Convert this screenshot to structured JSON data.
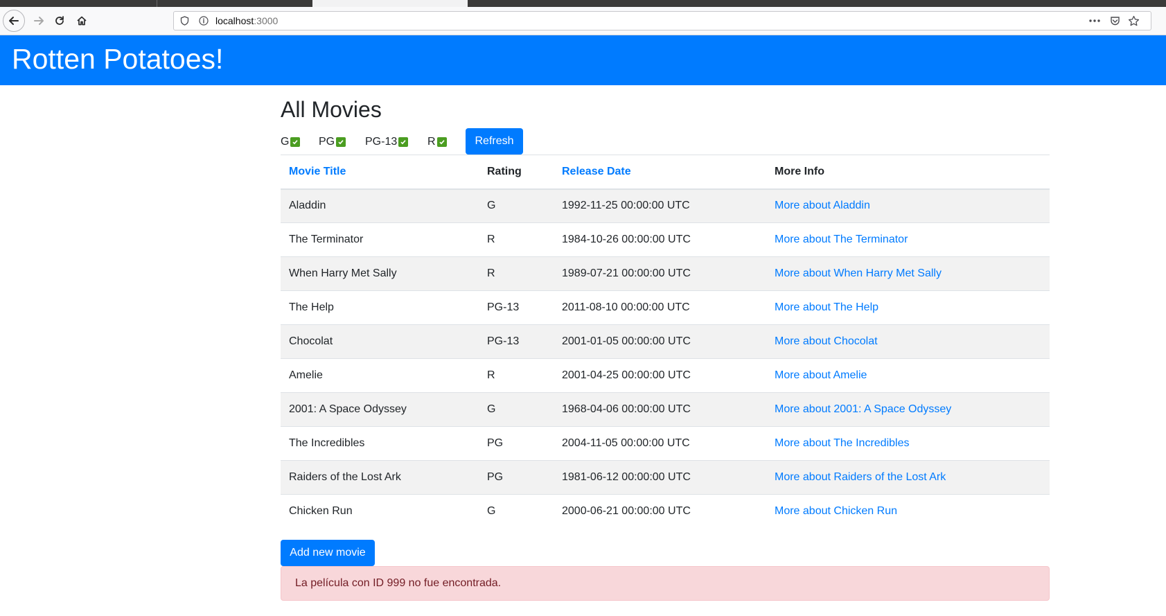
{
  "browser": {
    "url_host": "localhost",
    "url_port": ":3000"
  },
  "header": {
    "title": "Rotten Potatoes!",
    "color": "#007bff"
  },
  "main": {
    "title": "All Movies",
    "ratings": [
      {
        "label": "G",
        "checked": true
      },
      {
        "label": "PG",
        "checked": true
      },
      {
        "label": "PG-13",
        "checked": true
      },
      {
        "label": "R",
        "checked": true
      }
    ],
    "refresh_label": "Refresh",
    "columns": [
      "Movie Title",
      "Rating",
      "Release Date",
      "More Info"
    ],
    "movies": [
      {
        "title": "Aladdin",
        "rating": "G",
        "release_date": "1992-11-25 00:00:00 UTC",
        "more_info": "More about Aladdin"
      },
      {
        "title": "The Terminator",
        "rating": "R",
        "release_date": "1984-10-26 00:00:00 UTC",
        "more_info": "More about The Terminator"
      },
      {
        "title": "When Harry Met Sally",
        "rating": "R",
        "release_date": "1989-07-21 00:00:00 UTC",
        "more_info": "More about When Harry Met Sally"
      },
      {
        "title": "The Help",
        "rating": "PG-13",
        "release_date": "2011-08-10 00:00:00 UTC",
        "more_info": "More about The Help"
      },
      {
        "title": "Chocolat",
        "rating": "PG-13",
        "release_date": "2001-01-05 00:00:00 UTC",
        "more_info": "More about Chocolat"
      },
      {
        "title": "Amelie",
        "rating": "R",
        "release_date": "2001-04-25 00:00:00 UTC",
        "more_info": "More about Amelie"
      },
      {
        "title": "2001: A Space Odyssey",
        "rating": "G",
        "release_date": "1968-04-06 00:00:00 UTC",
        "more_info": "More about 2001: A Space Odyssey"
      },
      {
        "title": "The Incredibles",
        "rating": "PG",
        "release_date": "2004-11-05 00:00:00 UTC",
        "more_info": "More about The Incredibles"
      },
      {
        "title": "Raiders of the Lost Ark",
        "rating": "PG",
        "release_date": "1981-06-12 00:00:00 UTC",
        "more_info": "More about Raiders of the Lost Ark"
      },
      {
        "title": "Chicken Run",
        "rating": "G",
        "release_date": "2000-06-21 00:00:00 UTC",
        "more_info": "More about Chicken Run"
      }
    ],
    "add_label": "Add new movie",
    "flash_message": "La película con ID 999 no fue encontrada."
  }
}
